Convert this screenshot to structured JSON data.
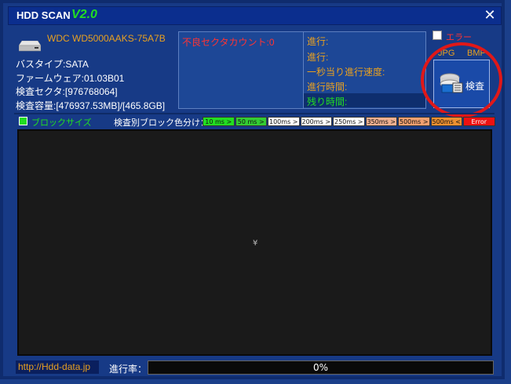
{
  "titlebar": {
    "app_name": "HDD SCAN",
    "version": "V2.0",
    "close_glyph": "✕"
  },
  "drive": {
    "model": "WDC WD5000AAKS-75A7B",
    "bus_type": "バスタイプ:SATA",
    "firmware": "ファームウェア:01.03B01",
    "sectors": "検査セクタ:[976768064]",
    "capacity": "検査容量:[476937.53MB]/[465.8GB]"
  },
  "stats": {
    "bad_sector_count": "不良セクタカウント:0",
    "progress_1": "進行:",
    "progress_2": "進行:",
    "speed": "一秒当り進行速度:",
    "elapsed": "進行時間:",
    "remaining": "残り時間:"
  },
  "options": {
    "error_label": "エラー",
    "jpg_label": "JPG",
    "bmp_label": "BMP"
  },
  "scan_button": {
    "label": "検査"
  },
  "legend": {
    "block_size_label": "ブロックサイズ",
    "color_by_label": "検査別ブロック色分け：",
    "chips": [
      {
        "label": "10 ms >",
        "color": "#22dd22"
      },
      {
        "label": "50 ms >",
        "color": "#33cc33"
      },
      {
        "label": "100ms >",
        "color": "#ffffff"
      },
      {
        "label": "200ms >",
        "color": "#ffffff"
      },
      {
        "label": "250ms >",
        "color": "#ffffff"
      },
      {
        "label": "350ms >",
        "color": "#f0b090"
      },
      {
        "label": "500ms >",
        "color": "#f0a070"
      },
      {
        "label": "500ms <",
        "color": "#ee9030"
      },
      {
        "label": "Error",
        "color": "#ee1111"
      }
    ]
  },
  "grid": {
    "cursor_glyph": "¥"
  },
  "footer": {
    "url": "http://Hdd-data.jp",
    "progress_label": "進行率：",
    "progress_text": "0%",
    "progress_fraction": 0
  }
}
